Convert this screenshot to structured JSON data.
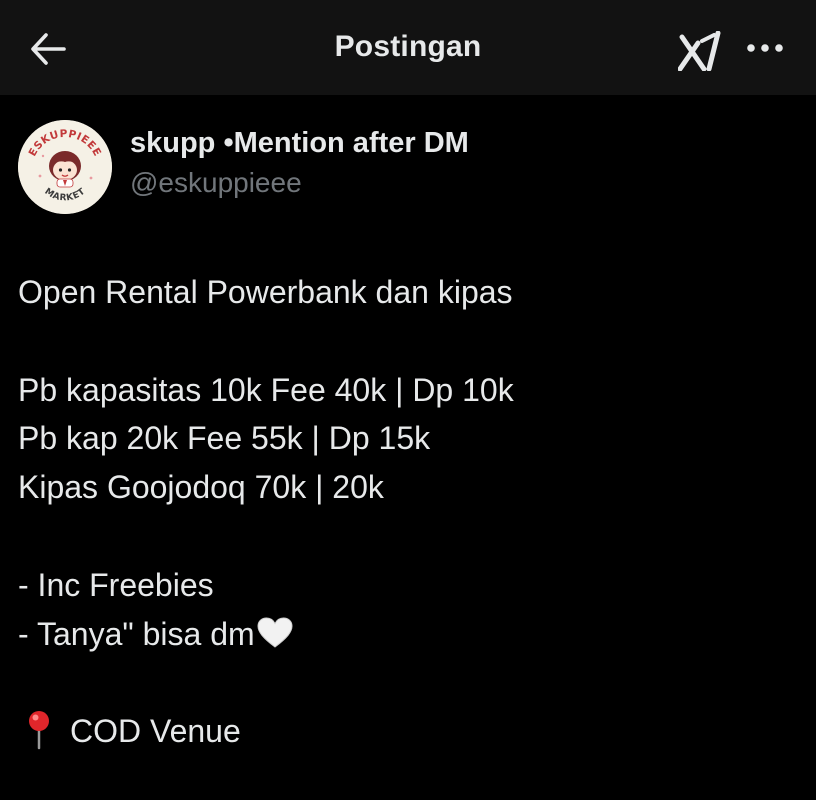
{
  "header": {
    "title": "Postingan",
    "back_icon": "arrow-left-icon",
    "grok_icon": "grok-icon",
    "more_icon": "more-horizontal-icon"
  },
  "author": {
    "display_name": "skupp •Mention after DM",
    "handle": "@eskuppieee",
    "avatar_text_top": "ESKUPPIEEE",
    "avatar_text_bottom": "MARKET"
  },
  "tweet": {
    "line1": "Open Rental Powerbank dan kipas",
    "line2": "Pb kapasitas 10k Fee 40k | Dp 10k",
    "line3": "Pb kap 20k Fee 55k | Dp 15k",
    "line4": "Kipas Goojodoq 70k | 20k",
    "line5": "- Inc Freebies",
    "line6": "- Tanya\" bisa dm",
    "line6_emoji": "white-heart-icon",
    "line7_emoji": "round-pushpin-icon",
    "line7": "COD Venue"
  },
  "colors": {
    "background": "#000000",
    "header_bg": "#121212",
    "text_primary": "#e7e9ea",
    "text_secondary": "#71767b"
  }
}
